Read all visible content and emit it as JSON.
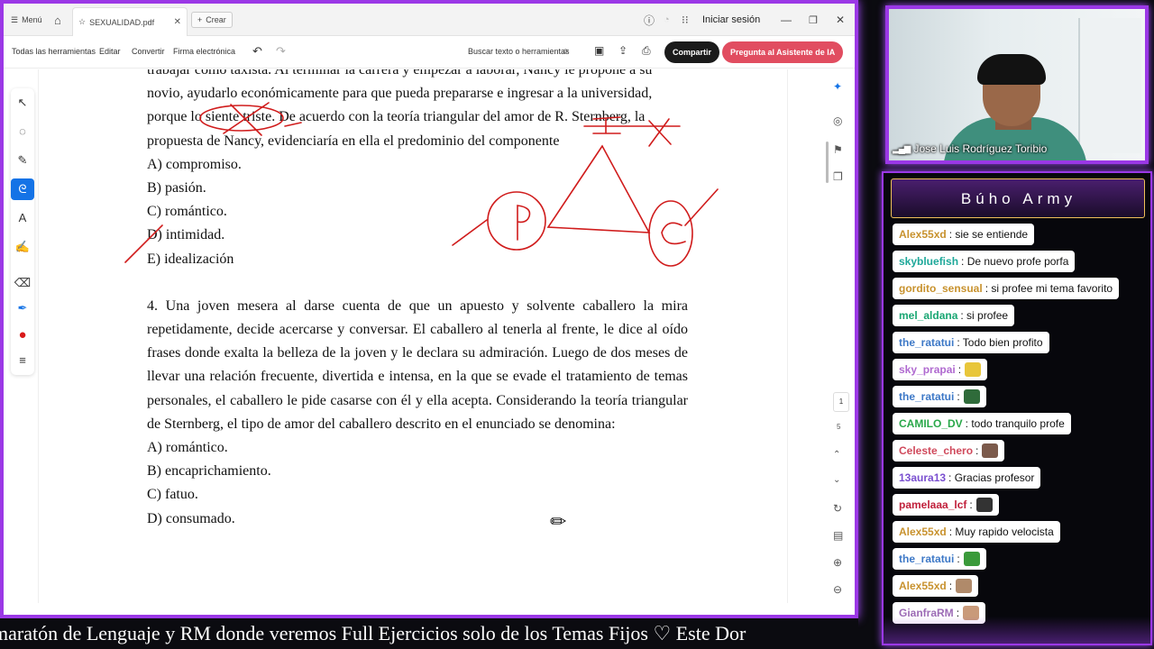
{
  "browser": {
    "menu_label": "Menú",
    "tab_title": "SEXUALIDAD.pdf",
    "create_label": "Crear",
    "signin_label": "Iniciar sesión"
  },
  "toolbar": {
    "all_tools": "Todas las herramientas",
    "edit": "Editar",
    "convert": "Convertir",
    "sign": "Firma electrónica",
    "search_placeholder": "Buscar texto o herramientas",
    "share_label": "Compartir",
    "ai_label": "Pregunta al Asistente de IA"
  },
  "document": {
    "q3_lines": [
      "trabajar como taxista. Al terminar la carrera y empezar a laborar, Nancy le propone a su",
      "novio, ayudarlo económicamente para que pueda prepararse e ingresar a la universidad,",
      "porque lo siente triste. De acuerdo con la teoría triangular del amor de R. Sternberg, la",
      "propuesta de Nancy, evidenciaría en ella el predominio del componente"
    ],
    "q3_options": [
      "A) compromiso.",
      "B) pasión.",
      "C) romántico.",
      "D) intimidad.",
      "E) idealización"
    ],
    "q4_text": "4. Una joven mesera al darse cuenta de que un apuesto y solvente caballero la mira repetidamente, decide acercarse y conversar. El caballero al tenerla al frente, le dice al oído frases donde exalta la belleza de la joven y le declara su admiración. Luego de dos meses de llevar una relación frecuente, divertida e intensa, en la que se evade el tratamiento de temas personales, el caballero le pide casarse con él y ella acepta. Considerando la teoría triangular de Sternberg, el tipo de amor del caballero descrito en el enunciado se denomina:",
    "q4_options": [
      "A) romántico.",
      "B) encaprichamiento.",
      "C) fatuo.",
      "D) consumado."
    ],
    "annotation_labels": {
      "top": "I",
      "left": "P",
      "right": "C"
    }
  },
  "pager": {
    "current": "1",
    "total": "5"
  },
  "ticker": {
    "text": "maratón de Lenguaje y RM donde veremos Full Ejercicios solo de los Temas Fijos ♡     Este Dor"
  },
  "webcam": {
    "name": "Jose Luis Rodríguez Toribio"
  },
  "chat": {
    "title": "Búho Army",
    "messages": [
      {
        "user": "Alex55xd",
        "color": "#c8922e",
        "text": ": sie se entiende",
        "emote": ""
      },
      {
        "user": "skybluefish",
        "color": "#1ea89a",
        "text": ": De nuevo profe porfa",
        "emote": ""
      },
      {
        "user": "gordito_sensual",
        "color": "#c8922e",
        "text": ": si profee mi tema favorito",
        "emote": ""
      },
      {
        "user": "mel_aldana",
        "color": "#19a673",
        "text": ": si profee",
        "emote": ""
      },
      {
        "user": "the_ratatui",
        "color": "#3e79c7",
        "text": ": Todo bien profito",
        "emote": ""
      },
      {
        "user": "sky_prapai",
        "color": "#b06ad0",
        "text": ":",
        "emote": "#e8c63a"
      },
      {
        "user": "the_ratatui",
        "color": "#3e79c7",
        "text": ":",
        "emote": "#2f6b3a"
      },
      {
        "user": "CAMILO_DV",
        "color": "#2aa84a",
        "text": ": todo tranquilo profe",
        "emote": ""
      },
      {
        "user": "Celeste_chero",
        "color": "#d04a5c",
        "text": ":",
        "emote": "#7b5a4b"
      },
      {
        "user": "13aura13",
        "color": "#7a4fd0",
        "text": ": Gracias profesor",
        "emote": ""
      },
      {
        "user": "pamelaaa_lcf",
        "color": "#c01f3a",
        "text": ":",
        "emote": "#333333"
      },
      {
        "user": "Alex55xd",
        "color": "#c8922e",
        "text": ": Muy rapido velocista",
        "emote": ""
      },
      {
        "user": "the_ratatui",
        "color": "#3e79c7",
        "text": ":",
        "emote": "#3a9a3a"
      },
      {
        "user": "Alex55xd",
        "color": "#c8922e",
        "text": ":",
        "emote": "#b08a6a"
      },
      {
        "user": "GianfraRM",
        "color": "#9c6ab5",
        "text": ":",
        "emote": "#c99a7a"
      }
    ]
  },
  "colors": {
    "frame": "#9b38e6",
    "ink": "#d01c1c",
    "share_btn": "#1b1b1b",
    "ai_btn": "#e14d60",
    "active_tool": "#1473e6"
  }
}
